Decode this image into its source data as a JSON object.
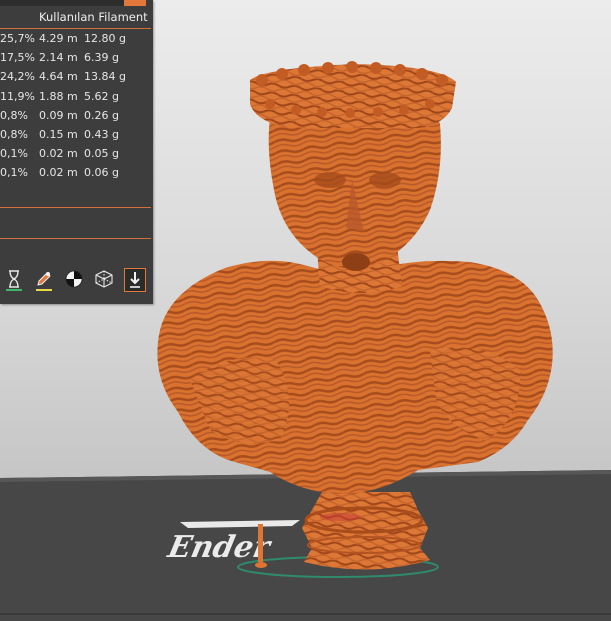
{
  "stats_panel": {
    "column_header": "Kullanılan Filament",
    "rows": [
      {
        "percent": "25,7%",
        "length": "4.29 m",
        "weight": "12.80 g"
      },
      {
        "percent": "17,5%",
        "length": "2.14 m",
        "weight": "6.39 g"
      },
      {
        "percent": "24,2%",
        "length": "4.64 m",
        "weight": "13.84 g"
      },
      {
        "percent": "11,9%",
        "length": "1.88 m",
        "weight": "5.62 g"
      },
      {
        "percent": "0,8%",
        "length": "0.09 m",
        "weight": "0.26 g"
      },
      {
        "percent": "0,8%",
        "length": "0.15 m",
        "weight": "0.43 g"
      },
      {
        "percent": "0,1%",
        "length": "0.02 m",
        "weight": "0.05 g"
      },
      {
        "percent": "0,1%",
        "length": "0.02 m",
        "weight": "0.06 g"
      }
    ],
    "toolbar": [
      {
        "name": "hourglass-icon",
        "underline": "#3fb56b"
      },
      {
        "name": "pen-edit-icon",
        "underline": "#e8d84a"
      },
      {
        "name": "color-wheel-icon",
        "underline": ""
      },
      {
        "name": "wireframe-cube-icon",
        "underline": ""
      },
      {
        "name": "export-down-arrow-icon",
        "underline": ""
      }
    ]
  },
  "colors": {
    "panel_bg": "#3d3d3d",
    "accent": "#e2773c",
    "model_orange": "#d86e2e",
    "model_stripe": "#a94f1f",
    "bed": "#4a4a4a"
  },
  "bed_logo_text": "Ender"
}
